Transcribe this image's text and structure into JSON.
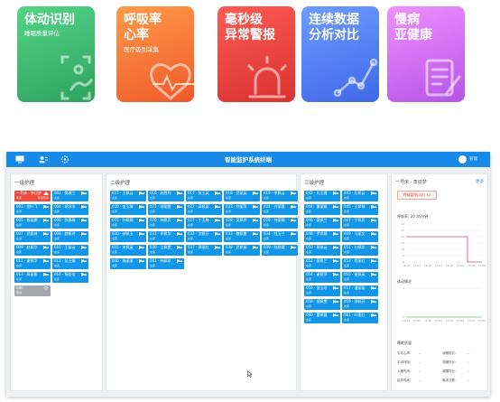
{
  "feature_cards": [
    {
      "title": "体动识别",
      "subtitle": "睡眠质量评估",
      "icon": "body-movement-icon"
    },
    {
      "title": "呼吸率\n心率",
      "subtitle": "医疗级别采集",
      "icon": "heart-pulse-icon"
    },
    {
      "title": "毫秒级\n异常警报",
      "subtitle": "",
      "icon": "alarm-light-icon"
    },
    {
      "title": "连续数据\n分析对比",
      "subtitle": "",
      "icon": "trend-chart-icon"
    },
    {
      "title": "慢病\n亚健康",
      "subtitle": "",
      "icon": "document-edit-icon"
    }
  ],
  "app": {
    "title": "智能监护系统终端",
    "user": "管理",
    "nav_icons": [
      "monitor-icon",
      "users-icon",
      "settings-icon"
    ]
  },
  "levels": [
    {
      "title": "一级护理",
      "beds": [
        {
          "name": "一号床 · 李日梦",
          "status": "离床",
          "extra": "呼吸暂停",
          "state": "alarm"
        },
        {
          "name": "002 · 樊珊兰",
          "status": "在床",
          "extra": "",
          "state": "normal"
        },
        {
          "name": "003 · 倪叶飞",
          "status": "在床",
          "extra": "",
          "state": "normal"
        },
        {
          "name": "004 · 胡冰冰",
          "status": "在床",
          "extra": "",
          "state": "normal"
        },
        {
          "name": "005 · 杨丽娜",
          "status": "在床",
          "extra": "",
          "state": "normal"
        },
        {
          "name": "006 · 张春梅",
          "status": "在床",
          "extra": "",
          "state": "normal"
        },
        {
          "name": "007 · 武佩林",
          "status": "在床",
          "extra": "",
          "state": "normal"
        },
        {
          "name": "008 · 赫佩玲",
          "status": "在床",
          "extra": "",
          "state": "normal"
        },
        {
          "name": "009 · 赵佩华",
          "status": "在床",
          "extra": "",
          "state": "normal"
        },
        {
          "name": "010 · 王丽云",
          "status": "在床",
          "extra": "",
          "state": "normal"
        },
        {
          "name": "011 · 谢佩华",
          "status": "在床",
          "extra": "",
          "state": "normal"
        },
        {
          "name": "012 · 彭玉娟",
          "status": "在床",
          "extra": "",
          "state": "normal"
        },
        {
          "name": "013 · 高丽影",
          "status": "在床",
          "extra": "",
          "state": "normal"
        },
        {
          "name": "014 · 杨佳佳",
          "status": "在床",
          "extra": "",
          "state": "normal"
        },
        {
          "name": "080",
          "status": "离线",
          "extra": "",
          "state": "offline"
        }
      ]
    },
    {
      "title": "二级护理",
      "beds": [
        {
          "name": "015 · 王佩云",
          "status": "在床",
          "extra": "",
          "state": "normal"
        },
        {
          "name": "016 · 赵胜利",
          "status": "在床",
          "extra": "",
          "state": "normal"
        },
        {
          "name": "017 · 张玉英",
          "status": "在床",
          "extra": "",
          "state": "normal"
        },
        {
          "name": "018 · 武丽英",
          "status": "在床",
          "extra": "",
          "state": "normal"
        },
        {
          "name": "019 · 李佩云",
          "status": "在床",
          "extra": "",
          "state": "normal"
        },
        {
          "name": "020 · 金玉梅",
          "status": "在床",
          "extra": "",
          "state": "normal"
        },
        {
          "name": "021 · 胡丽雯",
          "status": "在床",
          "extra": "",
          "state": "normal"
        },
        {
          "name": "022 · 高佩英",
          "status": "在床",
          "extra": "",
          "state": "normal"
        },
        {
          "name": "023 · 刘丽萍",
          "status": "在床",
          "extra": "",
          "state": "normal"
        },
        {
          "name": "024 · 方丽霞",
          "status": "在床",
          "extra": "",
          "state": "normal"
        },
        {
          "name": "025 · 孙佩娟",
          "status": "在床",
          "extra": "",
          "state": "normal"
        },
        {
          "name": "026 · 林佩芳",
          "status": "在床",
          "extra": "",
          "state": "normal"
        },
        {
          "name": "027 · 丁玉梅",
          "status": "在床",
          "extra": "",
          "state": "normal"
        },
        {
          "name": "028 · 吴佩玲",
          "status": "在床",
          "extra": "",
          "state": "normal"
        },
        {
          "name": "029 · 何丽娟",
          "status": "在床",
          "extra": "",
          "state": "normal"
        },
        {
          "name": "030 · 郝佩玉",
          "status": "在床",
          "extra": "",
          "state": "normal"
        },
        {
          "name": "031 · 祁佩华",
          "status": "在床",
          "extra": "",
          "state": "normal"
        },
        {
          "name": "032 · 沈佩芬",
          "status": "在床",
          "extra": "",
          "state": "normal"
        },
        {
          "name": "033 · 魏佩霞",
          "status": "在床",
          "extra": "",
          "state": "normal"
        },
        {
          "name": "034 · 钱玉兰",
          "status": "在床",
          "extra": "",
          "state": "normal"
        },
        {
          "name": "035 · 宋佩英",
          "status": "在床",
          "extra": "",
          "state": "normal"
        },
        {
          "name": "036 · 江佩雯",
          "status": "在床",
          "extra": "",
          "state": "normal"
        },
        {
          "name": "037 · 郭丽红",
          "status": "在床",
          "extra": "",
          "state": "normal"
        },
        {
          "name": "038 · 武佩丽",
          "status": "在床",
          "extra": "",
          "state": "normal"
        },
        {
          "name": "039 · 陆佩娥",
          "status": "在床",
          "extra": "",
          "state": "normal"
        },
        {
          "name": "040 · 施丽丽",
          "status": "在床",
          "extra": "",
          "state": "normal"
        },
        {
          "name": "041 · 韩佩珍",
          "status": "在床",
          "extra": "",
          "state": "normal"
        }
      ]
    },
    {
      "title": "三级护理",
      "beds": [
        {
          "name": "042 · 孔玉霞",
          "status": "在床",
          "extra": "",
          "state": "normal"
        },
        {
          "name": "043 · 石佩云",
          "status": "在床",
          "extra": "",
          "state": "normal"
        },
        {
          "name": "044 · 曹丽娟",
          "status": "在床",
          "extra": "",
          "state": "normal"
        },
        {
          "name": "045 · 王佩琴",
          "status": "在床",
          "extra": "",
          "state": "normal"
        },
        {
          "name": "046 · 戴佩兰",
          "status": "在床",
          "extra": "",
          "state": "normal"
        },
        {
          "name": "047 · 于佩芳",
          "status": "在床",
          "extra": "",
          "state": "normal"
        },
        {
          "name": "048 · 罗佩娟",
          "status": "在床",
          "extra": "",
          "state": "normal"
        },
        {
          "name": "049 · 马丽文",
          "status": "在床",
          "extra": "",
          "state": "normal"
        },
        {
          "name": "050 · 蔡佩云",
          "status": "在床",
          "extra": "",
          "state": "normal"
        },
        {
          "name": "051 · 杜佩华",
          "status": "在床",
          "extra": "",
          "state": "normal"
        },
        {
          "name": "052 · 薛佩兰",
          "status": "在床",
          "extra": "",
          "state": "normal"
        },
        {
          "name": "053 · 程丽红",
          "status": "在床",
          "extra": "",
          "state": "normal"
        },
        {
          "name": "054 · 谢佩萍",
          "status": "在床",
          "extra": "",
          "state": "normal"
        },
        {
          "name": "055 · 崔佩英",
          "status": "在床",
          "extra": "",
          "state": "normal"
        },
        {
          "name": "056 · 邹玉珍",
          "status": "在床",
          "extra": "",
          "state": "normal"
        },
        {
          "name": "057 · 潘丽丽",
          "status": "在床",
          "extra": "",
          "state": "normal"
        },
        {
          "name": "058 · 胡佩雯",
          "status": "在床",
          "extra": "",
          "state": "normal"
        },
        {
          "name": "059 · 邵佩芬",
          "status": "在床",
          "extra": "",
          "state": "normal"
        },
        {
          "name": "060 · 董佩霞",
          "status": "在床",
          "extra": "",
          "state": "normal"
        },
        {
          "name": "061 · 叶丽红",
          "status": "在床",
          "extra": "",
          "state": "normal"
        }
      ]
    }
  ],
  "detail": {
    "title": "一号床 · 李日梦",
    "link": "更多",
    "alert": "呼吸暂停(2次) 12",
    "resp_label": "呼吸率: 20 次/分钟",
    "resp_ylabels": [
      "30",
      "25",
      "20",
      "15",
      "10",
      "5",
      "0"
    ],
    "resp_xlabels": [
      "14:54",
      "14:55",
      "14:56",
      "14:57",
      "14:58",
      "14:59",
      "15:00",
      "15:01"
    ],
    "move_label": "体动情况",
    "move_ylabels": [
      "1",
      "0"
    ],
    "move_xlabels": [
      "14:54",
      "14:55",
      "14:56",
      "14:57",
      "14:58",
      "14:59",
      "15:00",
      "15:01"
    ],
    "sleep_label": "睡眠质量",
    "sleep_rows": [
      {
        "l": "平均心率:",
        "lv": "--",
        "r": "深睡时长:",
        "rv": "--"
      },
      {
        "l": "平均呼吸:",
        "lv": "--",
        "r": "浅睡时长:",
        "rv": "--"
      },
      {
        "l": "入睡时间:",
        "lv": "--",
        "r": "清醒时长:",
        "rv": "--"
      },
      {
        "l": "起床时间:",
        "lv": "--",
        "r": "离床次数:",
        "rv": "--"
      }
    ]
  },
  "chart_data": {
    "type": "line",
    "series": [
      {
        "values": [
          20,
          20,
          20,
          20,
          20,
          20,
          20,
          20,
          20,
          20,
          20,
          20,
          20,
          20,
          20,
          20,
          20,
          0,
          0,
          0,
          0,
          0
        ]
      }
    ],
    "ylim": [
      0,
      30
    ]
  },
  "colors": {
    "app_blue": "#1789e6",
    "tile_blue": "#1296e8",
    "alarm_red": "#ef4a40",
    "offline_gray": "#a4a8ad",
    "chart_line": "#d94a8a"
  }
}
